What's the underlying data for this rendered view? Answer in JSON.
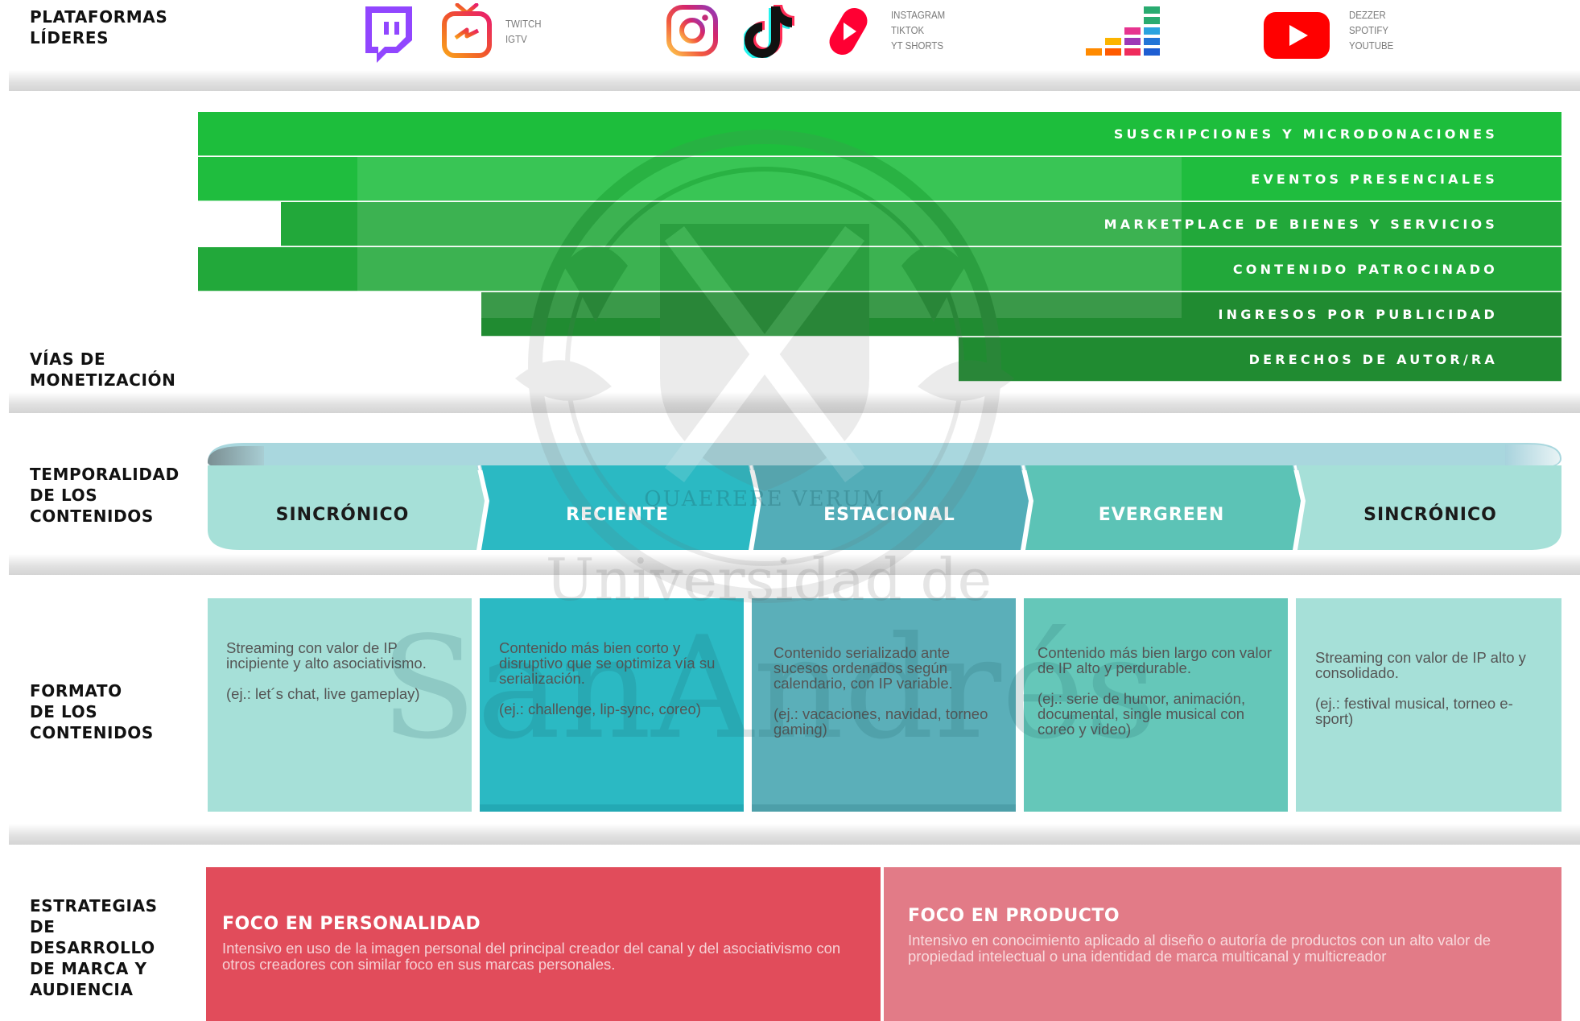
{
  "sections": {
    "plataformas": "PLATAFORMAS\nLÍDERES",
    "monetizacion": "VÍAS DE\nMONETIZACIÓN",
    "temporalidad": "TEMPORALIDAD\nDE LOS\nCONTENIDOS",
    "formato": "FORMATO\nDE LOS\nCONTENIDOS",
    "estrategias": "ESTRATEGIAS\nDE\nDESARROLLO\nDE MARCA Y\nAUDIENCIA"
  },
  "platforms": {
    "group1": [
      "TWITCH",
      "IGTV"
    ],
    "group2": [
      "INSTAGRAM",
      "TIKTOK",
      "YT SHORTS"
    ],
    "group3": [
      "DEZZER",
      "SPOTIFY",
      "YOUTUBE"
    ],
    "icons": [
      "twitch-icon",
      "igtv-icon",
      "instagram-icon",
      "tiktok-icon",
      "youtube-shorts-icon",
      "deezer-icon",
      "youtube-icon"
    ]
  },
  "monetizacion": [
    {
      "label": "SUSCRIPCIONES Y MICRODONACIONES",
      "color": "#1dbe3c"
    },
    {
      "label": "EVENTOS PRESENCIALES",
      "color": "#1fbd3e"
    },
    {
      "label": "MARKETPLACE DE BIENES Y SERVICIOS",
      "color": "#22a83a"
    },
    {
      "label": "CONTENIDO PATROCINADO",
      "color": "#22a83a"
    },
    {
      "label": "INGRESOS POR PUBLICIDAD",
      "color": "#208b31"
    },
    {
      "label": "DERECHOS DE AUTOR/RA",
      "color": "#208b31"
    }
  ],
  "temporalidad": [
    {
      "label": "SINCRÓNICO",
      "color": "#a6e0d8",
      "text_color": "#1a1a1a"
    },
    {
      "label": "RECIENTE",
      "color": "#2bb9c3",
      "text_color": "#ffffff"
    },
    {
      "label": "ESTACIONAL",
      "color": "#53adb8",
      "text_color": "#ffffff"
    },
    {
      "label": "EVERGREEN",
      "color": "#5cc3b6",
      "text_color": "#ffffff"
    },
    {
      "label": "SINCRÓNICO",
      "color": "#a6e0d8",
      "text_color": "#1a1a1a"
    }
  ],
  "formato": [
    {
      "color": "#a6e0d8",
      "lines": [
        "Streaming con valor de IP incipiente y alto asociativismo.",
        "(ej.: let´s chat, live gameplay)"
      ]
    },
    {
      "color": "#2bb9c3",
      "lines": [
        "Contenido más bien corto y disruptivo que se optimiza vía su serialización.",
        "(ej.: challenge, lip-sync, coreo)"
      ]
    },
    {
      "color": "#5bafb9",
      "lines": [
        "Contenido serializado ante sucesos ordenados según calendario, con IP variable.",
        "(ej.: vacaciones, navidad, torneo gaming)"
      ]
    },
    {
      "color": "#65c7b9",
      "lines": [
        "Contenido más bien largo con valor de IP alto y perdurable.",
        "(ej.: serie de humor, animación, documental, single musical con coreo y video)"
      ]
    },
    {
      "color": "#a6e0d8",
      "lines": [
        "Streaming con valor de IP alto y consolidado.",
        "(ej.: festival musical, torneo e-sport)"
      ]
    }
  ],
  "estrategias": [
    {
      "title": "FOCO EN PERSONALIDAD",
      "desc": "Intensivo en uso de la imagen personal del principal creador del canal y del asociativismo con otros creadores con similar foco en sus marcas personales.",
      "color": "#e14c5b"
    },
    {
      "title": "FOCO EN PRODUCTO",
      "desc": "Intensivo en conocimiento aplicado al diseño o autoría de productos con un alto valor de propiedad intelectual o una identidad de marca multicanal y multicreador",
      "color": "#e27b87"
    }
  ],
  "watermark": {
    "motto": "QUAERERE VERUM",
    "line1": "Universidad de",
    "line2": "SanAndrés"
  }
}
